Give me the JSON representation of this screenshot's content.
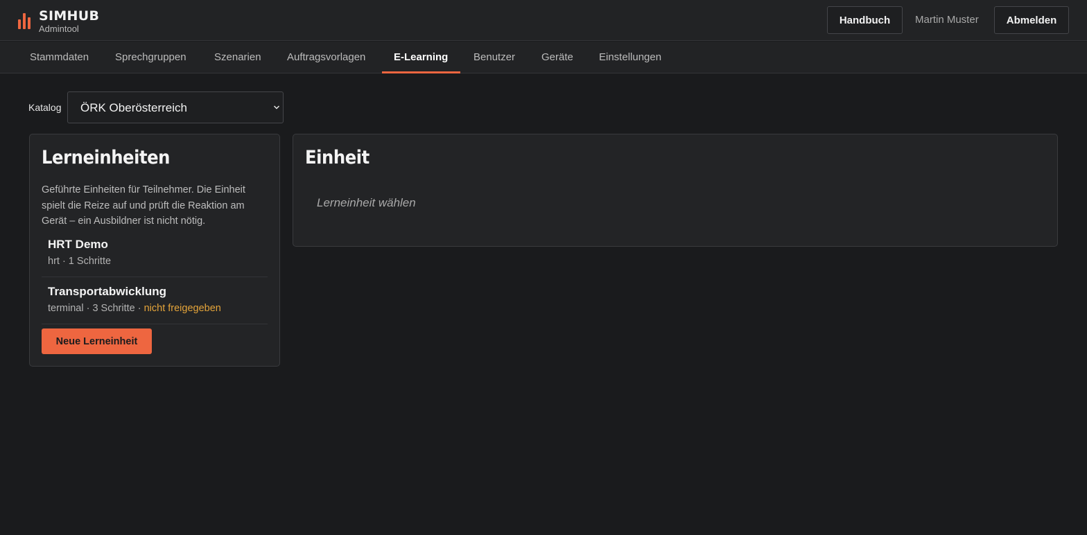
{
  "brand": {
    "name": "SIMHUB",
    "subtitle": "Admintool",
    "accent_color": "#ee6640",
    "logo_icon": "bar-chart-icon"
  },
  "header": {
    "handbook_label": "Handbuch",
    "user_name": "Martin Muster",
    "logout_label": "Abmelden"
  },
  "nav": {
    "items": [
      {
        "label": "Stammdaten"
      },
      {
        "label": "Sprechgruppen"
      },
      {
        "label": "Szenarien"
      },
      {
        "label": "Auftragsvorlagen"
      },
      {
        "label": "E-Learning"
      },
      {
        "label": "Benutzer"
      },
      {
        "label": "Geräte"
      },
      {
        "label": "Einstellungen"
      }
    ],
    "active": "E-Learning"
  },
  "catalog": {
    "label": "Katalog",
    "selected": "ÖRK Oberösterreich"
  },
  "units_panel": {
    "title": "Lerneinheiten",
    "description": "Geführte Einheiten für Teilnehmer. Die Einheit spielt die Reize auf und prüft die Reaktion am Gerät – ein Ausbildner ist nicht nötig.",
    "items": [
      {
        "title": "HRT Demo",
        "meta": "hrt · 1 Schritte",
        "status": ""
      },
      {
        "title": "Transportabwicklung",
        "meta": "terminal · 3 Schritte · ",
        "status": "nicht freigegeben"
      }
    ],
    "new_button_label": "Neue Lerneinheit",
    "warning_color": "#e4a43a"
  },
  "detail_panel": {
    "title": "Einheit",
    "placeholder": "Lerneinheit wählen"
  }
}
